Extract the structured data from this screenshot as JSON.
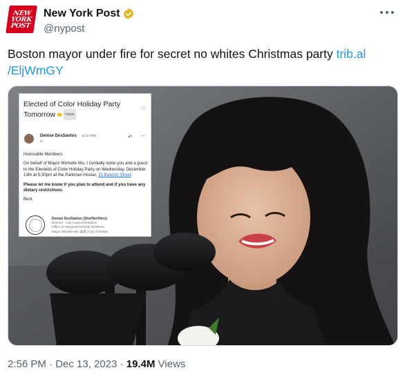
{
  "account": {
    "display_name": "New York Post",
    "handle": "@nypost",
    "logo_lines": [
      "NEW",
      "YORK",
      "POST"
    ]
  },
  "tweet": {
    "text": "Boston mayor under fire for secret no whites Christmas party ",
    "link_text": "trib.al\n/EljWmGY"
  },
  "email": {
    "subject": "Elected of Color Holiday Party Tomorrow",
    "inbox_label": "Inbox",
    "sender": "Denise DosSantos",
    "time": "12:24 PM",
    "to": "to",
    "greeting": "Honorable Members:",
    "body_1": "On behalf of Mayor Michelle Wu, I cordially invite you and a guest to the Electeds of Color Holiday Party on Wednesday, December 13th at 5:30pm at the Parkman House, ",
    "address": "33 Beacon Street",
    "body_period": ".",
    "body_2": "Please let me know if you plan to attend and if you have any dietary restrictions.",
    "closing": "Best,",
    "sig_name": "Denise DosSantos (She/Her/Hers)",
    "sig_title": "Director - City Council Relations",
    "sig_office": "Office of Intergovernmental Relations",
    "sig_org": "Mayor Michelle Wu 吳弭 | City of Boston"
  },
  "footer": {
    "time": "2:56 PM",
    "sep1": " · ",
    "date": "Dec 13, 2023",
    "sep2": " · ",
    "views": "19.4M",
    "views_label": " Views"
  },
  "colors": {
    "brand_red": "#d6001c",
    "link_blue": "#1d9bf0",
    "verified_gold": "#e2b719"
  }
}
